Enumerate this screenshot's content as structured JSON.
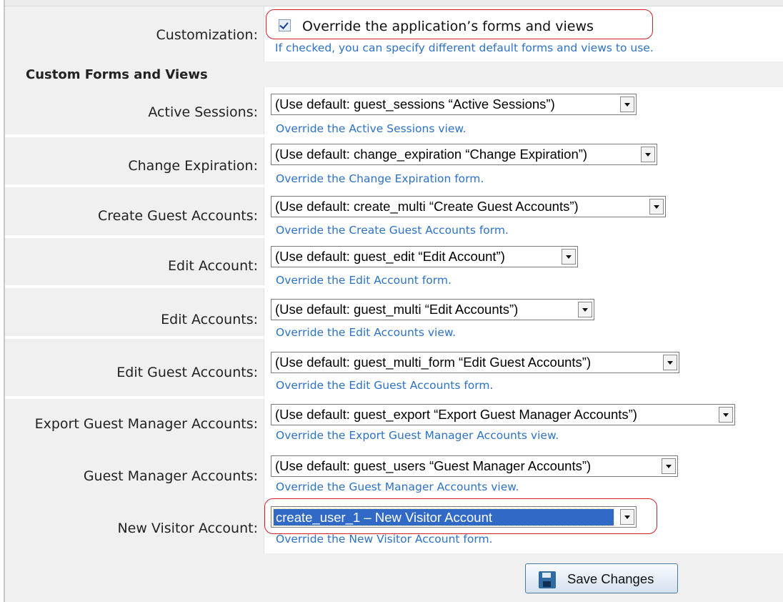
{
  "customization": {
    "label": "Customization:",
    "checkbox_label": "Override the application’s forms and views",
    "checked": true,
    "hint": "If checked, you can specify different default forms and views to use."
  },
  "section_title": "Custom Forms and Views",
  "rows": [
    {
      "label": "Active Sessions:",
      "value": "(Use default: guest_sessions “Active Sessions”)",
      "hint": "Override the Active Sessions view."
    },
    {
      "label": "Change Expiration:",
      "value": "(Use default: change_expiration “Change Expiration”)",
      "hint": "Override the Change Expiration form."
    },
    {
      "label": "Create Guest Accounts:",
      "value": "(Use default: create_multi “Create Guest Accounts”)",
      "hint": "Override the Create Guest Accounts form."
    },
    {
      "label": "Edit Account:",
      "value": "(Use default: guest_edit “Edit Account”)",
      "hint": "Override the Edit Account form."
    },
    {
      "label": "Edit Accounts:",
      "value": "(Use default: guest_multi “Edit Accounts”)",
      "hint": "Override the Edit Accounts view."
    },
    {
      "label": "Edit Guest Accounts:",
      "value": "(Use default: guest_multi_form “Edit Guest Accounts”)",
      "hint": "Override the Edit Guest Accounts form."
    },
    {
      "label": "Export Guest Manager Accounts:",
      "value": "(Use default: guest_export “Export Guest Manager Accounts”)",
      "hint": "Override the Export Guest Manager Accounts view."
    },
    {
      "label": "Guest Manager Accounts:",
      "value": "(Use default: guest_users “Guest Manager Accounts”)",
      "hint": "Override the Guest Manager Accounts view."
    },
    {
      "label": "New Visitor Account:",
      "value": "create_user_1 – New Visitor Account",
      "hint": "Override the New Visitor Account form."
    }
  ],
  "save_button": {
    "label": "Save Changes",
    "icon": "floppy-disk-icon"
  },
  "colors": {
    "hint": "#2d72c7",
    "highlight_box": "#d21f2a",
    "selected": "#3169c6"
  }
}
